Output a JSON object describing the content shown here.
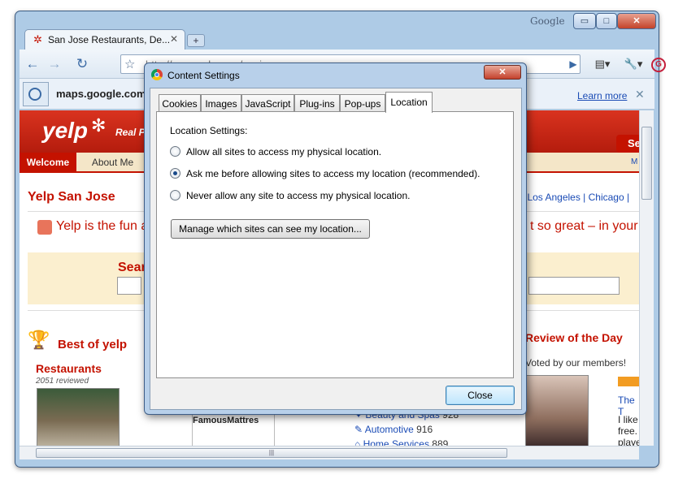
{
  "window": {
    "brand": "Google",
    "minimize": "▭",
    "maximize": "□",
    "close": "✕"
  },
  "tab": {
    "favicon": "✲",
    "title": "San Jose Restaurants, De...",
    "close": "✕",
    "new_tab": "+"
  },
  "toolbar": {
    "back": "←",
    "forward": "→",
    "reload": "↻",
    "star": "☆",
    "url": "http://www.yelp.com/sanjose",
    "maps_icon": "G",
    "go": "▶",
    "page_menu": "▤▾",
    "wrench_menu": "🔧▾"
  },
  "infobar": {
    "text": "maps.google.com",
    "learn_more": "Learn more",
    "close": "✕"
  },
  "page": {
    "logo": "yelp",
    "burst": "✻",
    "tagline_head": "Real P",
    "nav": {
      "welcome": "Welcome",
      "about": "About Me",
      "more": "M"
    },
    "city": "Yelp San Jose",
    "other_cities": "| Los Angeles | Chicago |",
    "tagline": "Yelp is the fun a",
    "tagline_right": "t so great – in your a",
    "search_label": "Searc",
    "search_button": "Se",
    "best_of": "Best of yelp",
    "restaurants": "Restaurants",
    "reviewed": "2051 reviewed",
    "mattress": "FamousMattres",
    "categories": [
      {
        "icon": "✦",
        "name": "Beauty and Spas",
        "count": "928"
      },
      {
        "icon": "✎",
        "name": "Automotive",
        "count": "916"
      },
      {
        "icon": "⌂",
        "name": "Home Services",
        "count": "889"
      }
    ],
    "review_day": "Review of the Day",
    "voted": "Voted by our members!",
    "the_t": "The T",
    "like_lines": "I like\nfree.\nplaye"
  },
  "scrollbars": {
    "hgrip": "|||"
  },
  "dialog": {
    "title": "Content Settings",
    "close": "✕",
    "tabs": [
      "Cookies",
      "Images",
      "JavaScript",
      "Plug-ins",
      "Pop-ups",
      "Location"
    ],
    "selected_tab": "Location",
    "heading": "Location Settings:",
    "options": [
      "Allow all sites to access my physical location.",
      "Ask me before allowing sites to access my location (recommended).",
      "Never allow any site to access my physical location."
    ],
    "selected_option": 1,
    "manage_button": "Manage which sites can see my location...",
    "close_button": "Close"
  }
}
